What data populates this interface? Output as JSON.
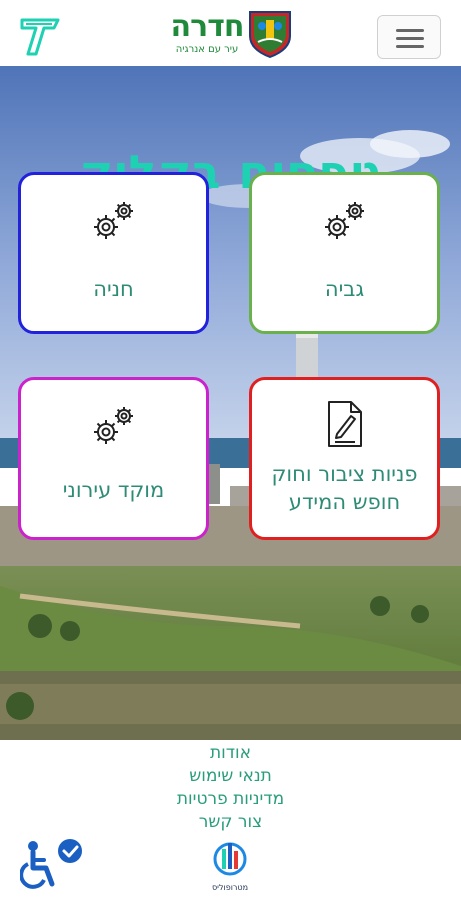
{
  "header": {
    "brand_name": "חדרה",
    "brand_slogan": "עיר עם אנרגיה",
    "menu_label": "menu"
  },
  "hero": {
    "title": "טפסים בקליק"
  },
  "tiles": [
    {
      "label": "גביה",
      "icon": "gears-icon",
      "border": "#6ab04c"
    },
    {
      "label": "חניה",
      "icon": "gears-icon",
      "border": "#2222dd"
    },
    {
      "label": "פניות ציבור וחוק חופש המידע",
      "icon": "document-edit-icon",
      "border": "#e02020"
    },
    {
      "label": "מוקד עירוני",
      "icon": "gears-icon",
      "border": "#cc22cc"
    }
  ],
  "footer": {
    "links": [
      {
        "label": "אודות"
      },
      {
        "label": "תנאי שימוש"
      },
      {
        "label": "מדיניות פרטיות"
      },
      {
        "label": "צור קשר"
      }
    ],
    "partner_label": "מטרופוליס"
  },
  "colors": {
    "accent": "#1ed1b2",
    "brand_green": "#1f8a3a",
    "link": "#2a9d7c"
  }
}
